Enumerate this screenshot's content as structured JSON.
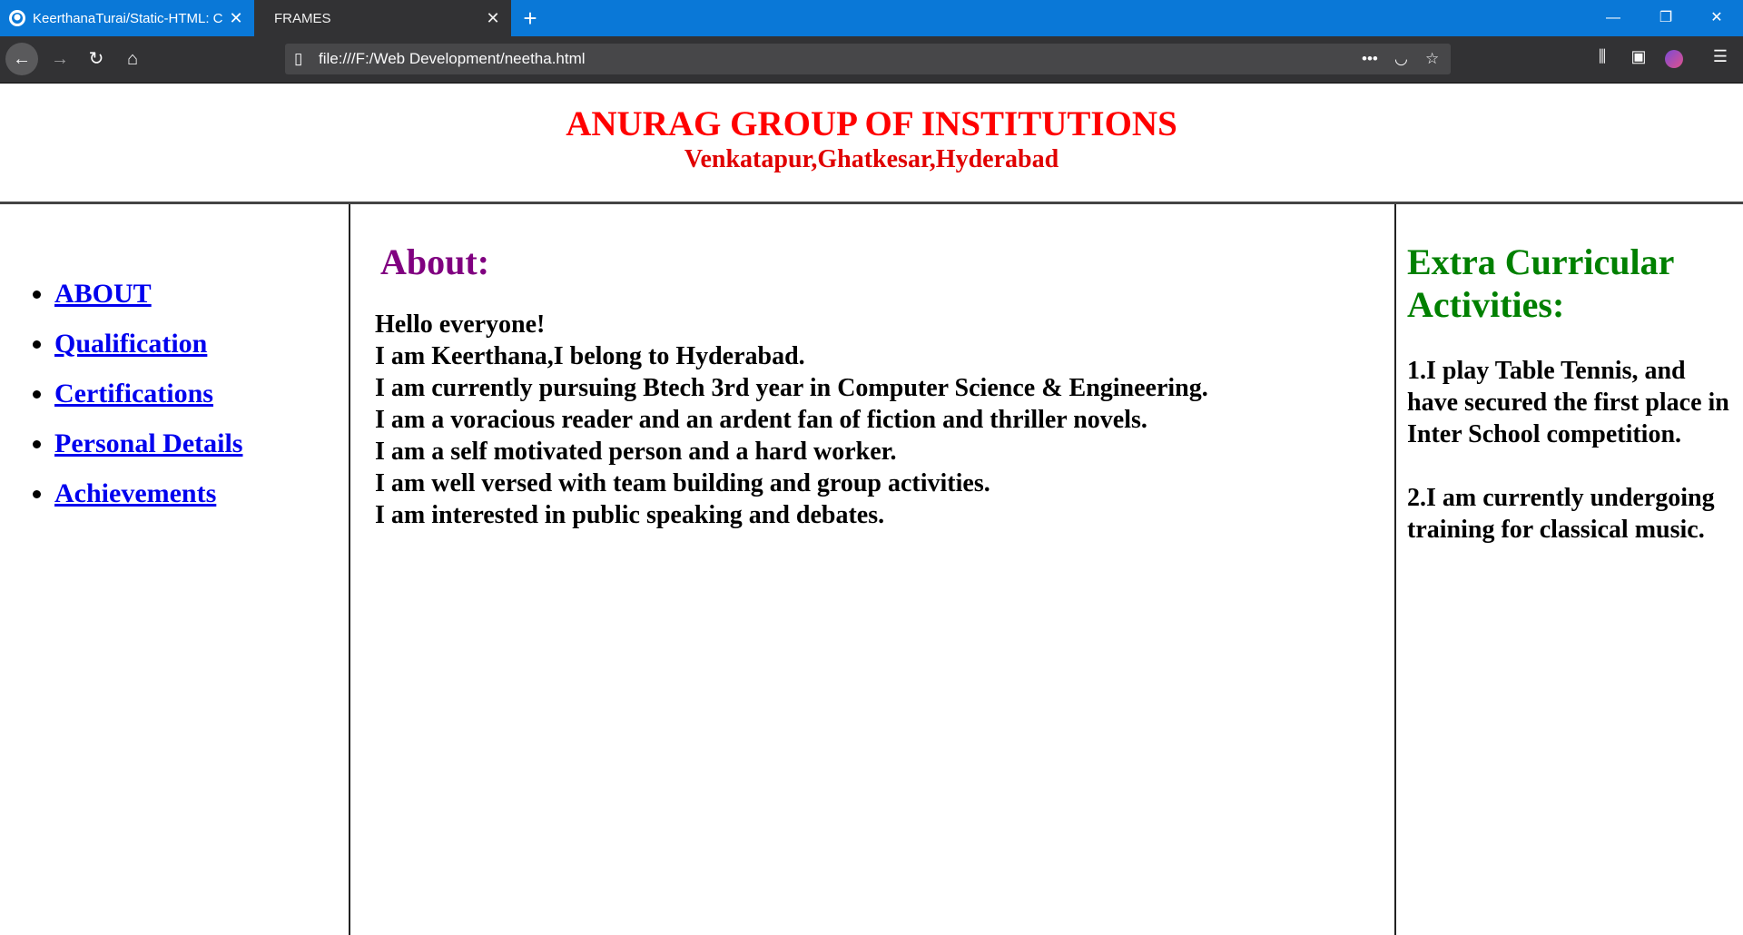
{
  "browser": {
    "tabs": [
      {
        "title": "KeerthanaTurai/Static-HTML: C",
        "icon": "github-icon"
      },
      {
        "title": "FRAMES"
      }
    ],
    "new_tab_icon": "plus-icon",
    "url": "file:///F:/Web Development/neetha.html",
    "window_controls": [
      "minimize-icon",
      "restore-icon",
      "close-icon"
    ]
  },
  "header": {
    "institution": "ANURAG GROUP OF INSTITUTIONS",
    "location": "Venkatapur,Ghatkesar,Hyderabad"
  },
  "menu": {
    "items": [
      "ABOUT",
      "Qualification",
      "Certifications",
      "Personal Details",
      "Achievements"
    ]
  },
  "about": {
    "heading": "About:",
    "lines": [
      "Hello everyone!",
      "I am Keerthana,I belong to Hyderabad.",
      "I am currently pursuing Btech 3rd year in Computer Science & Engineering.",
      "I am a voracious reader and an ardent fan of fiction and thriller novels.",
      "I am a self motivated person and a hard worker.",
      "I am well versed with team building and group activities.",
      "I am interested in public speaking and debates."
    ]
  },
  "extra": {
    "heading": "Extra Curricular Activities:",
    "items": [
      "1.I play Table Tennis, and have secured the first place in Inter School competition.",
      "2.I am currently undergoing training for classical music."
    ]
  },
  "colors": {
    "institution": "#ff0000",
    "about_heading": "#800080",
    "extra_heading": "#008000",
    "link": "#0000ee"
  }
}
